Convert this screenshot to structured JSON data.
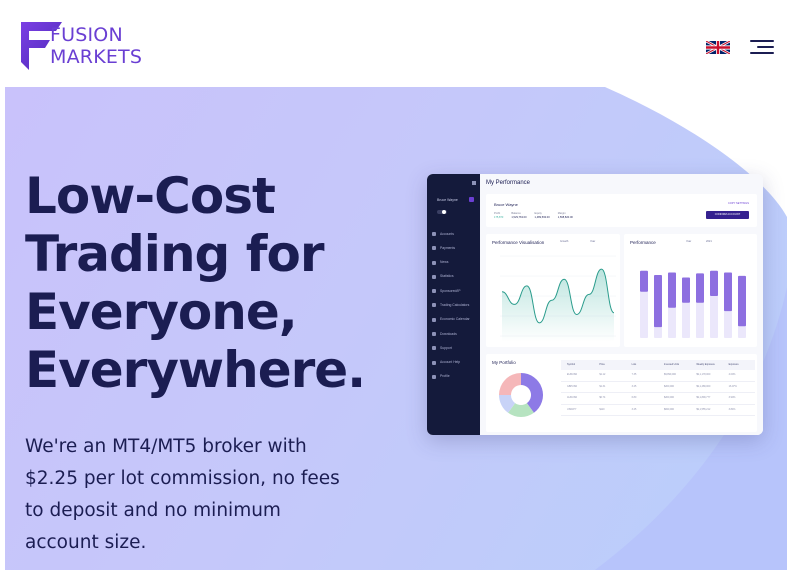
{
  "brand": {
    "line1": "FUSION",
    "line2": "MARKETS",
    "colors": {
      "accent": "#6a3fd3",
      "navy": "#1b1d52",
      "hero_gradient_start": "#c9c2fb",
      "hero_gradient_end": "#b9cffb"
    }
  },
  "header": {
    "language_icon": "uk-flag-icon",
    "menu_icon": "hamburger-menu-icon"
  },
  "hero": {
    "headline_lines": [
      "Low-Cost",
      "Trading for",
      "Everyone,",
      "Everywhere."
    ],
    "lead": "We're an MT4/MT5 broker with $2.25 per lot commission, no fees to deposit and no minimum account size."
  },
  "dashboard": {
    "sidebar_user": "Bruce Wayne",
    "sidebar_items": [
      "Accounts",
      "Payments",
      "News",
      "Statistics",
      "Sponsored/IP",
      "Trading Calculators",
      "Economic Calendar",
      "Downloads",
      "Support",
      "Account Help",
      "Profile"
    ],
    "title": "My Performance",
    "profile_name": "Bruce Wayne",
    "stats": [
      {
        "label": "Profit",
        "value": "175,873"
      },
      {
        "label": "Balance",
        "value": "1,529,763.00"
      },
      {
        "label": "Equity",
        "value": "1,489,593.00"
      },
      {
        "label": "Margin",
        "value": "1,598,820.00"
      }
    ],
    "copy_settings": "COPY SETTINGS",
    "confirm_account": "CONFIRM ACCOUNT",
    "visualisation_title": "Performance Visualisation",
    "visualisation_filters": [
      "Growth",
      "Year"
    ],
    "performance_title": "Performance",
    "performance_filters": [
      "Year",
      "2021"
    ],
    "portfolio_title": "My Portfolio",
    "table_headers": [
      "Symbol",
      "Price",
      "Lots",
      "Invested Units",
      "Weekly Exposure",
      "Exposure"
    ],
    "table_rows": [
      [
        "EURUSD",
        "$1.12",
        "7.35",
        "$9,899,000",
        "$9,1,178,000",
        "4.00%"
      ],
      [
        "GBPUSD",
        "$1.31",
        "3.25",
        "$200,000",
        "$9,1,489,000",
        "16.07%"
      ],
      [
        "AUDUSD",
        "$0.74",
        "6.80",
        "$200,000",
        "$9,1,899,777",
        "3.90%"
      ],
      [
        "USDJPY",
        "$110",
        "3.25",
        "$820,000",
        "$9,1,555,212",
        "3.84%"
      ]
    ],
    "line_series": [
      0.55,
      0.4,
      0.62,
      0.18,
      0.45,
      0.7,
      0.28,
      0.52,
      0.82,
      0.3
    ],
    "bar_series": [
      {
        "total": 0.8,
        "fill": 0.25
      },
      {
        "total": 0.75,
        "fill": 0.62
      },
      {
        "total": 0.78,
        "fill": 0.42
      },
      {
        "total": 0.72,
        "fill": 0.3
      },
      {
        "total": 0.77,
        "fill": 0.35
      },
      {
        "total": 0.8,
        "fill": 0.3
      },
      {
        "total": 0.78,
        "fill": 0.46
      },
      {
        "total": 0.74,
        "fill": 0.6
      }
    ],
    "donut_slices": [
      {
        "value": 40,
        "color": "#8d7ae6"
      },
      {
        "value": 20,
        "color": "#b6e3c0"
      },
      {
        "value": 15,
        "color": "#c8d3f7"
      },
      {
        "value": 25,
        "color": "#f5b7b9"
      }
    ]
  }
}
